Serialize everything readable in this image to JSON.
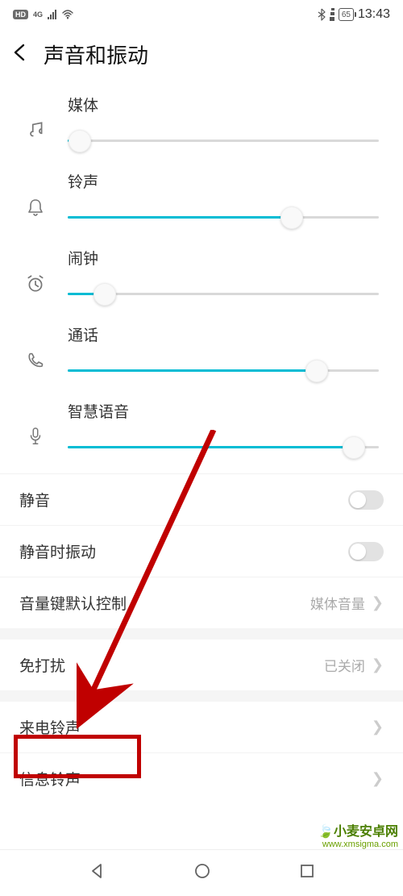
{
  "status": {
    "hd": "HD",
    "net": "4G",
    "battery_text": "65",
    "time": "13:43"
  },
  "header": {
    "title": "声音和振动"
  },
  "sliders": [
    {
      "label": "媒体",
      "value": 4
    },
    {
      "label": "铃声",
      "value": 72
    },
    {
      "label": "闹钟",
      "value": 12
    },
    {
      "label": "通话",
      "value": 80
    },
    {
      "label": "智慧语音",
      "value": 92
    }
  ],
  "rows": {
    "mute": "静音",
    "vibrate_on_mute": "静音时振动",
    "volume_key_default": {
      "label": "音量键默认控制",
      "value": "媒体音量"
    },
    "dnd": {
      "label": "免打扰",
      "value": "已关闭"
    },
    "incoming_ringtone": "来电铃声",
    "message_ringtone": "信息铃声"
  },
  "watermark": {
    "title": "小麦安卓网",
    "sub": "www.xmsigma.com"
  }
}
